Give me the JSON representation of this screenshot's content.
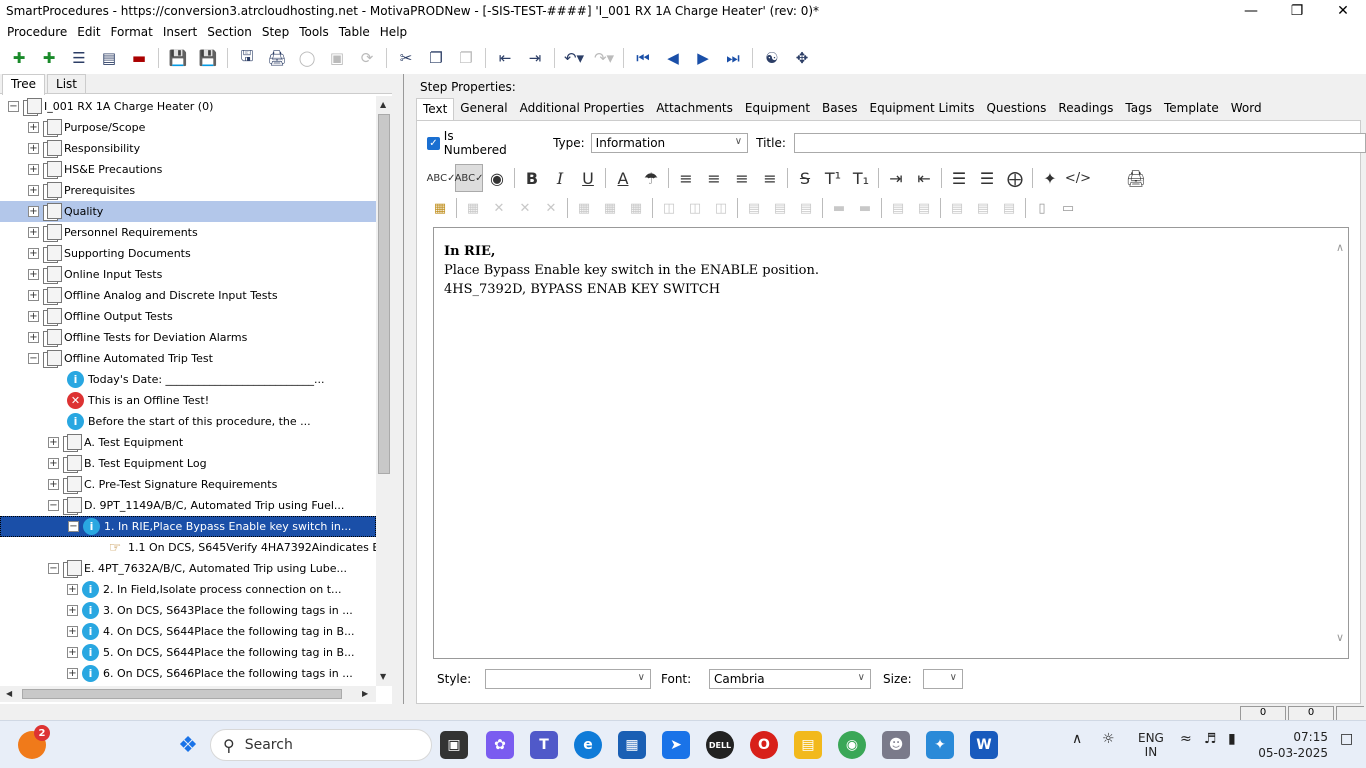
{
  "window": {
    "title": "SmartProcedures - https://conversion3.atrcloudhosting.net - MotivaPRODNew - [-SIS-TEST-####] 'I_001 RX 1A Charge Heater' (rev: 0)*"
  },
  "menu": [
    "Procedure",
    "Edit",
    "Format",
    "Insert",
    "Section",
    "Step",
    "Tools",
    "Table",
    "Help"
  ],
  "left_tabs": [
    "Tree",
    "List"
  ],
  "tree": {
    "root": "I_001 RX 1A Charge Heater (0)",
    "items": [
      {
        "label": "Purpose/Scope"
      },
      {
        "label": "Responsibility"
      },
      {
        "label": "HS&E Precautions"
      },
      {
        "label": "Prerequisites"
      },
      {
        "label": "Quality"
      },
      {
        "label": "Personnel Requirements"
      },
      {
        "label": "Supporting Documents"
      },
      {
        "label": "Online Input Tests"
      },
      {
        "label": "Offline Analog and Discrete Input Tests"
      },
      {
        "label": "Offline Output Tests"
      },
      {
        "label": "Offline Tests for Deviation Alarms"
      },
      {
        "label": "Offline Automated Trip Test"
      },
      {
        "label": "Today's Date: ___________________________..."
      },
      {
        "label": "This is an Offline Test!"
      },
      {
        "label": "Before the start of this procedure, the ..."
      },
      {
        "label": "A. Test Equipment"
      },
      {
        "label": "B. Test Equipment Log"
      },
      {
        "label": "C. Pre-Test Signature Requirements"
      },
      {
        "label": "D. 9PT_1149A/B/C, Automated Trip using Fuel..."
      },
      {
        "label": "1. In RIE,Place Bypass Enable key switch in..."
      },
      {
        "label": "1.1  On DCS,  S645Verify 4HA7392Aindicates E..."
      },
      {
        "label": "E. 4PT_7632A/B/C, Automated Trip using Lube..."
      },
      {
        "label": "2. In Field,Isolate process connection on t..."
      },
      {
        "label": "3. On DCS, S643Place the following tags in ..."
      },
      {
        "label": "4. On DCS, S644Place the following tag in B..."
      },
      {
        "label": "5. On DCS, S644Place the following tag in B..."
      },
      {
        "label": "6. On DCS, S646Place the following tags in ..."
      }
    ]
  },
  "step_properties": {
    "heading": "Step Properties:",
    "tabs": [
      "Text",
      "General",
      "Additional Properties",
      "Attachments",
      "Equipment",
      "Bases",
      "Equipment Limits",
      "Questions",
      "Readings",
      "Tags",
      "Template",
      "Word"
    ],
    "is_numbered_label": "Is Numbered",
    "type_label": "Type:",
    "type_value": "Information",
    "title_label": "Title:",
    "title_value": "",
    "editor_lines": {
      "line1": "In RIE,",
      "line2": "Place Bypass Enable key switch in the ENABLE position.",
      "line3": "4HS_7392D, BYPASS ENAB KEY SWITCH"
    },
    "style_label": "Style:",
    "style_value": "",
    "font_label": "Font:",
    "font_value": "Cambria",
    "size_label": "Size:",
    "size_value": ""
  },
  "status": {
    "box1": "0",
    "box2": "0"
  },
  "taskbar": {
    "search_placeholder": "Search",
    "notification_count": "2",
    "lang1": "ENG",
    "lang2": "IN",
    "time": "07:15",
    "date": "05-03-2025"
  }
}
